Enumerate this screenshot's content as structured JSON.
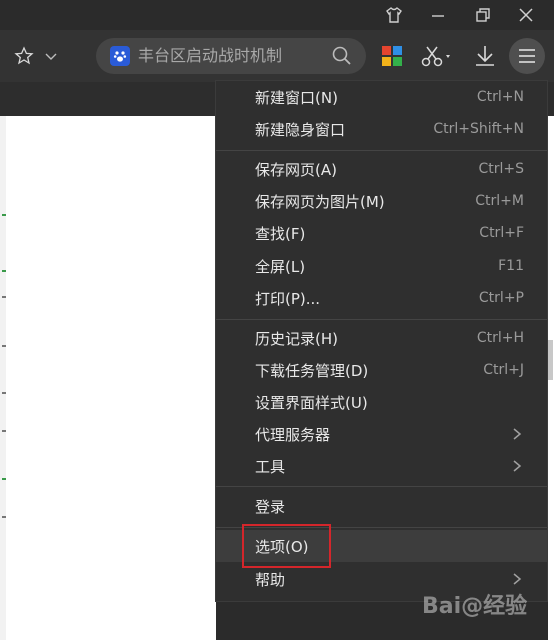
{
  "address_bar": {
    "text": "丰台区启动战时机制"
  },
  "menu": {
    "items": [
      {
        "label": "新建窗口(N)",
        "shortcut": "Ctrl+N"
      },
      {
        "label": "新建隐身窗口",
        "shortcut": "Ctrl+Shift+N"
      },
      {
        "label": "保存网页(A)",
        "shortcut": "Ctrl+S"
      },
      {
        "label": "保存网页为图片(M)",
        "shortcut": "Ctrl+M"
      },
      {
        "label": "查找(F)",
        "shortcut": "Ctrl+F"
      },
      {
        "label": "全屏(L)",
        "shortcut": "F11"
      },
      {
        "label": "打印(P)...",
        "shortcut": "Ctrl+P"
      },
      {
        "label": "历史记录(H)",
        "shortcut": "Ctrl+H"
      },
      {
        "label": "下载任务管理(D)",
        "shortcut": "Ctrl+J"
      },
      {
        "label": "设置界面样式(U)",
        "shortcut": ""
      },
      {
        "label": "代理服务器",
        "shortcut": ""
      },
      {
        "label": "工具",
        "shortcut": ""
      },
      {
        "label": "登录",
        "shortcut": ""
      },
      {
        "label": "选项(O)",
        "shortcut": ""
      },
      {
        "label": "帮助",
        "shortcut": ""
      }
    ]
  },
  "watermark": {
    "text": "Bai@经验"
  },
  "colors": {
    "highlight_box": "#d4262b",
    "menu_bg": "#2f2f2f"
  }
}
